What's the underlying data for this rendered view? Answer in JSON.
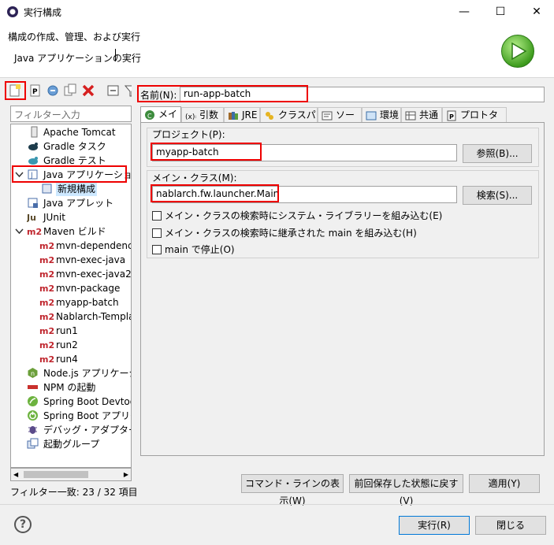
{
  "window": {
    "title": "実行構成",
    "minimize": "—",
    "maximize": "☐",
    "close": "✕"
  },
  "header": {
    "title": "構成の作成、管理、および実行",
    "message": "Java アプリケーションの実行"
  },
  "filter": {
    "placeholder": "フィルター入力",
    "status": "フィルター一致: 23 / 32 項目"
  },
  "tree": [
    {
      "label": "Apache Tomcat",
      "icon": "tomcat-icon"
    },
    {
      "label": "Gradle タスク",
      "icon": "gradle-icon"
    },
    {
      "label": "Gradle テスト",
      "icon": "gradle-test-icon"
    },
    {
      "label": "Java アプリケーション",
      "icon": "java-app-icon"
    },
    {
      "label": "新規構成",
      "icon": "config-icon"
    },
    {
      "label": "Java アプレット",
      "icon": "applet-icon"
    },
    {
      "label": "JUnit",
      "icon": "junit-icon"
    },
    {
      "label": "Maven ビルド",
      "icon": "maven-icon"
    },
    {
      "label": "mvn-dependency",
      "icon": "m2-icon"
    },
    {
      "label": "mvn-exec-java",
      "icon": "m2-icon"
    },
    {
      "label": "mvn-exec-java2",
      "icon": "m2-icon"
    },
    {
      "label": "mvn-package",
      "icon": "m2-icon"
    },
    {
      "label": "myapp-batch",
      "icon": "m2-icon"
    },
    {
      "label": "Nablarch-Templat",
      "icon": "m2-icon"
    },
    {
      "label": "run1",
      "icon": "m2-icon"
    },
    {
      "label": "run2",
      "icon": "m2-icon"
    },
    {
      "label": "run4",
      "icon": "m2-icon"
    },
    {
      "label": "Node.js アプリケーション",
      "icon": "nodejs-icon"
    },
    {
      "label": "NPM の起動",
      "icon": "npm-icon"
    },
    {
      "label": "Spring Boot Devtools",
      "icon": "spring-devtools-icon"
    },
    {
      "label": "Spring Boot アプリケーション",
      "icon": "spring-boot-icon"
    },
    {
      "label": "デバッグ・アダプター・ランチャー",
      "icon": "debug-adapter-icon"
    },
    {
      "label": "起動グループ",
      "icon": "launch-group-icon"
    }
  ],
  "m2": "m2",
  "name": {
    "label": "名前(N):",
    "value": "run-app-batch"
  },
  "tabs": [
    "メイン",
    "引数",
    "JRE",
    "クラスパス",
    "ソース",
    "環境",
    "共通",
    "プロトタイプ"
  ],
  "main": {
    "project_label": "プロジェクト(P):",
    "project_value": "myapp-batch",
    "browse_button": "参照(B)...",
    "mainclass_label": "メイン・クラス(M):",
    "mainclass_value": "nablarch.fw.launcher.Main",
    "search_button": "検索(S)...",
    "opt_system_libs": "メイン・クラスの検索時にシステム・ライブラリーを組み込む(E)",
    "opt_inherited_main": "メイン・クラスの検索時に継承された main を組み込む(H)",
    "opt_stop_in_main": "main で停止(O)"
  },
  "buttons": {
    "show_cmdline": "コマンド・ラインの表示(W)",
    "revert": "前回保存した状態に戻す(V)",
    "apply": "適用(Y)",
    "run": "実行(R)",
    "close": "閉じる",
    "help": "?"
  }
}
